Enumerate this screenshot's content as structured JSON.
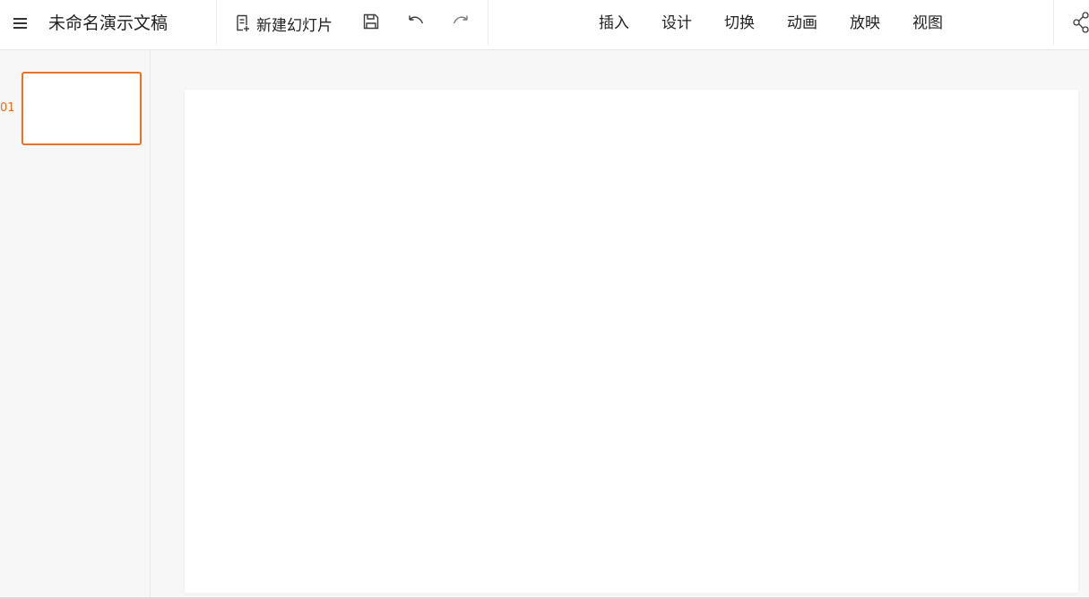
{
  "document": {
    "title": "未命名演示文稿"
  },
  "toolbar": {
    "menu_icon": "hamburger-menu-icon",
    "new_slide_label": "新建幻灯片",
    "new_slide_icon": "new-slide-icon",
    "save_icon": "save-icon",
    "undo_icon": "undo-icon",
    "redo_icon": "redo-icon",
    "share_icon": "share-icon"
  },
  "tabs": [
    {
      "label": "插入"
    },
    {
      "label": "设计"
    },
    {
      "label": "切换"
    },
    {
      "label": "动画"
    },
    {
      "label": "放映"
    },
    {
      "label": "视图"
    }
  ],
  "slides": [
    {
      "number": "01",
      "selected": true
    }
  ],
  "colors": {
    "accent": "#f07020",
    "slide_number": "#e8711d",
    "toolbar_background": "#ffffff",
    "workspace_background": "#f7f7f7"
  }
}
